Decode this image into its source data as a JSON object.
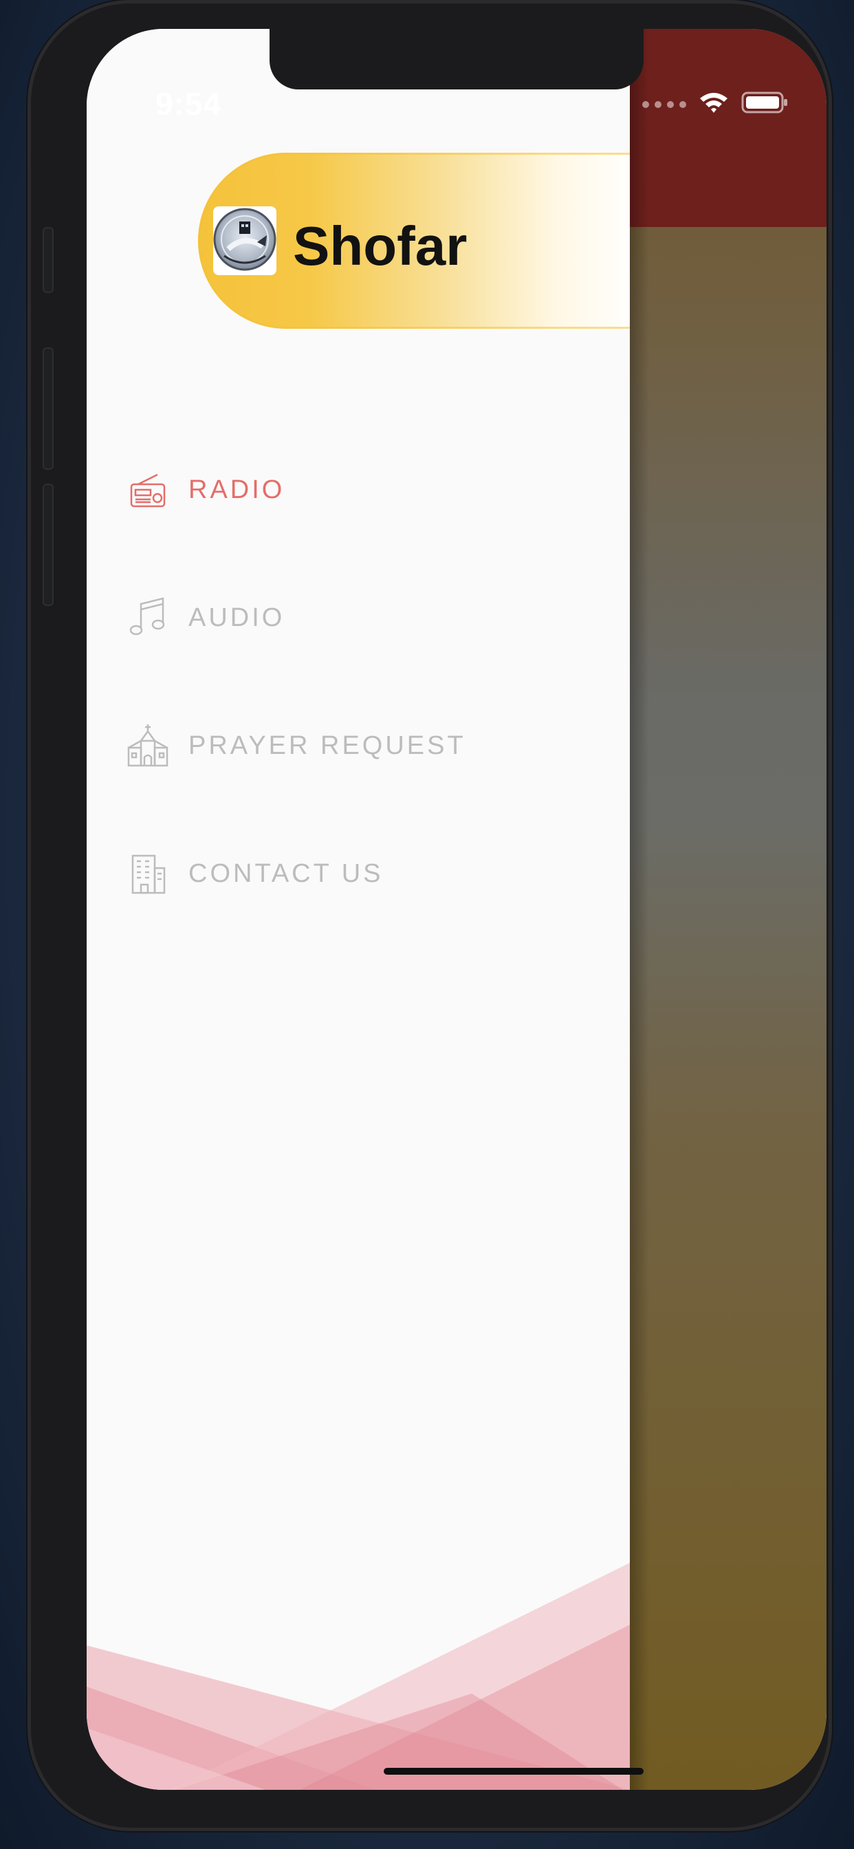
{
  "status_bar": {
    "time": "9:54",
    "signal_icon": "signal-dots",
    "wifi_icon": "wifi-icon",
    "battery_icon": "battery-icon"
  },
  "drawer": {
    "title": "Shofar",
    "logo_icon": "shofar-logo",
    "menu": [
      {
        "label": "RADIO",
        "icon": "radio-icon",
        "active": true
      },
      {
        "label": "AUDIO",
        "icon": "music-note-icon",
        "active": false
      },
      {
        "label": "PRAYER REQUEST",
        "icon": "church-icon",
        "active": false
      },
      {
        "label": "CONTACT US",
        "icon": "building-icon",
        "active": false
      }
    ]
  },
  "colors": {
    "accent": "#e56d69",
    "menu_text": "#bcbcbc",
    "header_gradient_start": "#f5c23b",
    "background": "#fafafa",
    "overlay_top": "#6e201c",
    "overlay_main": "#725b22"
  }
}
